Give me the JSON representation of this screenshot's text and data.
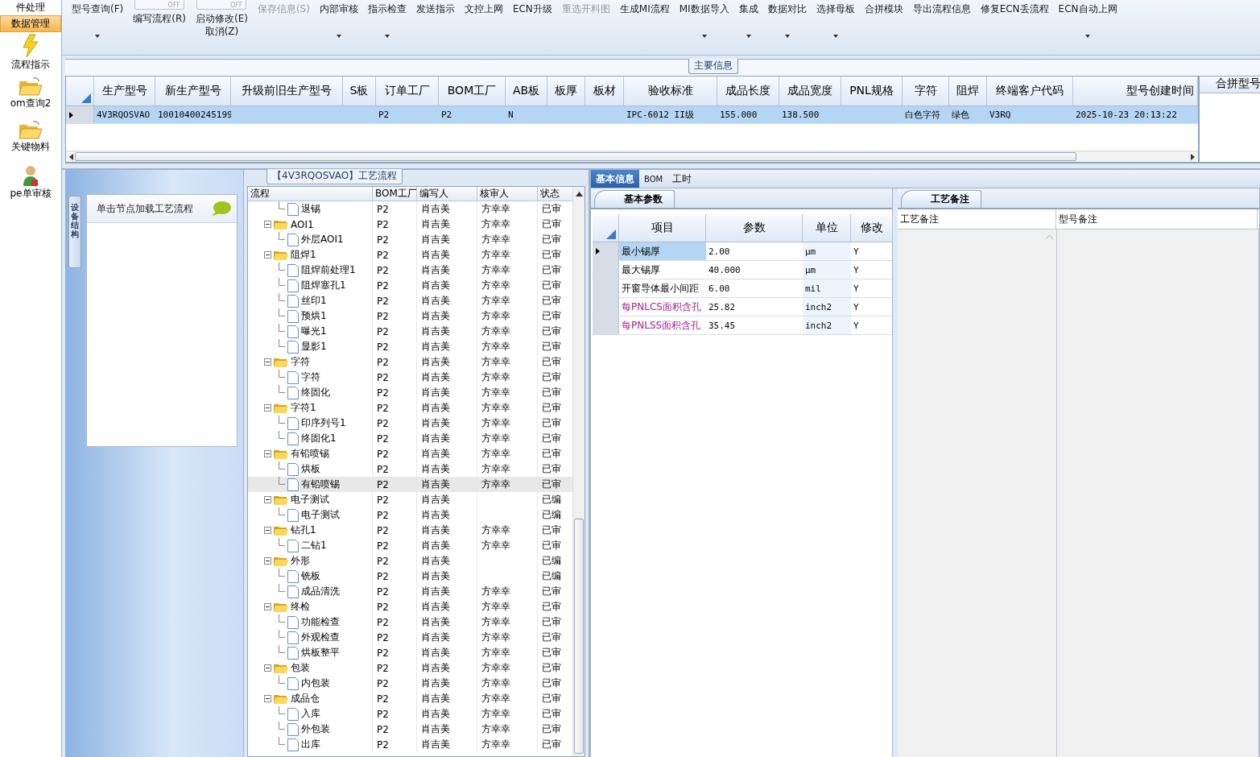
{
  "sidebar": {
    "items": [
      {
        "label": "件处理",
        "selected": false
      },
      {
        "label": "数据管理",
        "selected": true
      },
      {
        "label": "流程指示",
        "selected": false
      },
      {
        "label": "om查询2",
        "selected": false
      },
      {
        "label": "关键物料",
        "selected": false
      },
      {
        "label": "pe单审核",
        "selected": false
      }
    ]
  },
  "toolbar": [
    {
      "kind": "button",
      "label": "型号查询(F)",
      "dropdown": true,
      "disabled": false
    },
    {
      "kind": "toggle",
      "toggle_text": "OFF",
      "label": "编写流程(R)",
      "dropdown": false,
      "disabled": false
    },
    {
      "kind": "toggle",
      "toggle_text": "OFF",
      "label": "启动修改(E)",
      "label2": "取消(Z)",
      "dropdown": false,
      "disabled": false
    },
    {
      "kind": "button",
      "label": "保存信息(S)",
      "dropdown": false,
      "disabled": true
    },
    {
      "kind": "button",
      "label": "内部审核",
      "dropdown": true,
      "disabled": false
    },
    {
      "kind": "button",
      "label": "指示检查",
      "dropdown": true,
      "disabled": false
    },
    {
      "kind": "button",
      "label": "发送指示",
      "dropdown": false,
      "disabled": false
    },
    {
      "kind": "button",
      "label": "文控上网",
      "dropdown": false,
      "disabled": false
    },
    {
      "kind": "button",
      "label": "ECN升级",
      "dropdown": false,
      "disabled": false
    },
    {
      "kind": "button",
      "label": "重选开料图",
      "dropdown": false,
      "disabled": true
    },
    {
      "kind": "button",
      "label": "生成MI流程",
      "dropdown": false,
      "disabled": false
    },
    {
      "kind": "button",
      "label": "MI数据导入",
      "dropdown": true,
      "disabled": false
    },
    {
      "kind": "button",
      "label": "集成",
      "dropdown": true,
      "disabled": false
    },
    {
      "kind": "button",
      "label": "数据对比",
      "dropdown": true,
      "disabled": false
    },
    {
      "kind": "button",
      "label": "选择母板",
      "dropdown": true,
      "disabled": false
    },
    {
      "kind": "button",
      "label": "合拼模块",
      "dropdown": false,
      "disabled": false
    },
    {
      "kind": "button",
      "label": "导出流程信息",
      "dropdown": false,
      "disabled": false
    },
    {
      "kind": "button",
      "label": "修复ECN丢流程",
      "dropdown": false,
      "disabled": false
    },
    {
      "kind": "button",
      "label": "ECN自动上网",
      "dropdown": true,
      "disabled": false
    }
  ],
  "main_info": {
    "title": "主要信息",
    "columns": [
      "生产型号",
      "新生产型号",
      "升级前旧生产型号",
      "S板",
      "订单工厂",
      "BOM工厂",
      "AB板",
      "板厚",
      "板材",
      "验收标准",
      "成品长度",
      "成品宽度",
      "PNL规格",
      "字符",
      "阻焊",
      "终端客户代码",
      "型号创建时间"
    ],
    "rows": [
      {
        "selected": true,
        "cells": [
          "4V3RQOSVAO",
          "10010400245199",
          null,
          null,
          "P2",
          "P2",
          "N",
          null,
          null,
          "IPC-6012 II级",
          "155.000",
          "138.500",
          null,
          "白色字符",
          "绿色",
          "V3RQ",
          "2025-10-23 20:13:22"
        ]
      }
    ],
    "side_column": "合拼型号"
  },
  "structure_panel": {
    "tab": "设备结构",
    "hint": "单击节点加载工艺流程"
  },
  "flow": {
    "title": "【4V3RQOSVAO】工艺流程",
    "columns": [
      "流程",
      "BOM工厂",
      "编写人",
      "核审人",
      "状态"
    ],
    "nodes": [
      {
        "kind": "step",
        "name": "退锡",
        "bom": "P2",
        "author": "肖吉美",
        "reviewer": "方幸幸",
        "status": "已审",
        "selected": false
      },
      {
        "kind": "group",
        "name": "AOI1",
        "bom": "P2",
        "author": "肖吉美",
        "reviewer": "方幸幸",
        "status": "已审",
        "selected": false,
        "expanded": true,
        "children": [
          {
            "kind": "step",
            "name": "外层AOI1",
            "bom": "P2",
            "author": "肖吉美",
            "reviewer": "方幸幸",
            "status": "已审",
            "selected": false
          }
        ]
      },
      {
        "kind": "group",
        "name": "阻焊1",
        "bom": "P2",
        "author": "肖吉美",
        "reviewer": "方幸幸",
        "status": "已审",
        "selected": false,
        "expanded": true,
        "children": [
          {
            "kind": "step",
            "name": "阻焊前处理1",
            "bom": "P2",
            "author": "肖吉美",
            "reviewer": "方幸幸",
            "status": "已审",
            "selected": false
          },
          {
            "kind": "step",
            "name": "阻焊塞孔1",
            "bom": "P2",
            "author": "肖吉美",
            "reviewer": "方幸幸",
            "status": "已审",
            "selected": false
          },
          {
            "kind": "step",
            "name": "丝印1",
            "bom": "P2",
            "author": "肖吉美",
            "reviewer": "方幸幸",
            "status": "已审",
            "selected": false
          },
          {
            "kind": "step",
            "name": "预烘1",
            "bom": "P2",
            "author": "肖吉美",
            "reviewer": "方幸幸",
            "status": "已审",
            "selected": false
          },
          {
            "kind": "step",
            "name": "曝光1",
            "bom": "P2",
            "author": "肖吉美",
            "reviewer": "方幸幸",
            "status": "已审",
            "selected": false
          },
          {
            "kind": "step",
            "name": "显影1",
            "bom": "P2",
            "author": "肖吉美",
            "reviewer": "方幸幸",
            "status": "已审",
            "selected": false
          }
        ]
      },
      {
        "kind": "group",
        "name": "字符",
        "bom": "P2",
        "author": "肖吉美",
        "reviewer": "方幸幸",
        "status": "已审",
        "selected": false,
        "expanded": true,
        "children": [
          {
            "kind": "step",
            "name": "字符",
            "bom": "P2",
            "author": "肖吉美",
            "reviewer": "方幸幸",
            "status": "已审",
            "selected": false
          },
          {
            "kind": "step",
            "name": "终固化",
            "bom": "P2",
            "author": "肖吉美",
            "reviewer": "方幸幸",
            "status": "已审",
            "selected": false
          }
        ]
      },
      {
        "kind": "group",
        "name": "字符1",
        "bom": "P2",
        "author": "肖吉美",
        "reviewer": "方幸幸",
        "status": "已审",
        "selected": false,
        "expanded": true,
        "children": [
          {
            "kind": "step",
            "name": "印序列号1",
            "bom": "P2",
            "author": "肖吉美",
            "reviewer": "方幸幸",
            "status": "已审",
            "selected": false
          },
          {
            "kind": "step",
            "name": "终固化1",
            "bom": "P2",
            "author": "肖吉美",
            "reviewer": "方幸幸",
            "status": "已审",
            "selected": false
          }
        ]
      },
      {
        "kind": "group",
        "name": "有铅喷锡",
        "bom": "P2",
        "author": "肖吉美",
        "reviewer": "方幸幸",
        "status": "已审",
        "selected": false,
        "expanded": true,
        "children": [
          {
            "kind": "step",
            "name": "烘板",
            "bom": "P2",
            "author": "肖吉美",
            "reviewer": "方幸幸",
            "status": "已审",
            "selected": false
          },
          {
            "kind": "step",
            "name": "有铅喷锡",
            "bom": "P2",
            "author": "肖吉美",
            "reviewer": "方幸幸",
            "status": "已审",
            "selected": true
          }
        ]
      },
      {
        "kind": "group",
        "name": "电子测试",
        "bom": "P2",
        "author": "肖吉美",
        "status": "已编",
        "selected": false,
        "expanded": true,
        "children": [
          {
            "kind": "step",
            "name": "电子测试",
            "bom": "P2",
            "author": "肖吉美",
            "status": "已编",
            "selected": false
          }
        ]
      },
      {
        "kind": "group",
        "name": "钻孔1",
        "bom": "P2",
        "author": "肖吉美",
        "reviewer": "方幸幸",
        "status": "已审",
        "selected": false,
        "expanded": true,
        "children": [
          {
            "kind": "step",
            "name": "二钻1",
            "bom": "P2",
            "author": "肖吉美",
            "reviewer": "方幸幸",
            "status": "已审",
            "selected": false
          }
        ]
      },
      {
        "kind": "group",
        "name": "外形",
        "bom": "P2",
        "author": "肖吉美",
        "status": "已编",
        "selected": false,
        "expanded": true,
        "children": [
          {
            "kind": "step",
            "name": "铣板",
            "bom": "P2",
            "author": "肖吉美",
            "status": "已编",
            "selected": false
          },
          {
            "kind": "step",
            "name": "成品清洗",
            "bom": "P2",
            "author": "肖吉美",
            "reviewer": "方幸幸",
            "status": "已审",
            "selected": false
          }
        ]
      },
      {
        "kind": "group",
        "name": "终检",
        "bom": "P2",
        "author": "肖吉美",
        "reviewer": "方幸幸",
        "status": "已审",
        "selected": false,
        "expanded": true,
        "children": [
          {
            "kind": "step",
            "name": "功能检查",
            "bom": "P2",
            "author": "肖吉美",
            "reviewer": "方幸幸",
            "status": "已审",
            "selected": false
          },
          {
            "kind": "step",
            "name": "外观检查",
            "bom": "P2",
            "author": "肖吉美",
            "reviewer": "方幸幸",
            "status": "已审",
            "selected": false
          },
          {
            "kind": "step",
            "name": "烘板整平",
            "bom": "P2",
            "author": "肖吉美",
            "reviewer": "方幸幸",
            "status": "已审",
            "selected": false
          }
        ]
      },
      {
        "kind": "group",
        "name": "包装",
        "bom": "P2",
        "author": "肖吉美",
        "reviewer": "方幸幸",
        "status": "已审",
        "selected": false,
        "expanded": true,
        "children": [
          {
            "kind": "step",
            "name": "内包装",
            "bom": "P2",
            "author": "肖吉美",
            "reviewer": "方幸幸",
            "status": "已审",
            "selected": false
          }
        ]
      },
      {
        "kind": "group",
        "name": "成品仓",
        "bom": "P2",
        "author": "肖吉美",
        "reviewer": "方幸幸",
        "status": "已审",
        "selected": false,
        "expanded": true,
        "children": [
          {
            "kind": "step",
            "name": "入库",
            "bom": "P2",
            "author": "肖吉美",
            "reviewer": "方幸幸",
            "status": "已审",
            "selected": false
          },
          {
            "kind": "step",
            "name": "外包装",
            "bom": "P2",
            "author": "肖吉美",
            "reviewer": "方幸幸",
            "status": "已审",
            "selected": false
          },
          {
            "kind": "step",
            "name": "出库",
            "bom": "P2",
            "author": "肖吉美",
            "reviewer": "方幸幸",
            "status": "已审",
            "selected": false
          }
        ]
      }
    ]
  },
  "detail_tabs": [
    {
      "label": "基本信息",
      "selected": true
    },
    {
      "label": "BOM",
      "selected": false
    },
    {
      "label": "工时",
      "selected": false
    }
  ],
  "params": {
    "tab": "基本参数",
    "columns": [
      "项目",
      "参数",
      "单位",
      "修改"
    ],
    "rows": [
      {
        "item": "最小锡厚",
        "value": "2.00",
        "unit": "µm",
        "modified": "Y",
        "highlighted": false,
        "selected": true
      },
      {
        "item": "最大锡厚",
        "value": "40.000",
        "unit": "µm",
        "modified": "Y",
        "highlighted": false,
        "selected": false
      },
      {
        "item": "开窗导体最小间距",
        "value": "6.00",
        "unit": "mil",
        "modified": "Y",
        "highlighted": false,
        "selected": false
      },
      {
        "item": "每PNLCS面积含孔",
        "value": "25.82",
        "unit": "inch2",
        "modified": "Y",
        "highlighted": true,
        "selected": false
      },
      {
        "item": "每PNLSS面积含孔",
        "value": "35.45",
        "unit": "inch2",
        "modified": "Y",
        "highlighted": true,
        "selected": false
      }
    ]
  },
  "notes": {
    "tab": "工艺备注",
    "columns": [
      "工艺备注",
      "型号备注"
    ]
  }
}
